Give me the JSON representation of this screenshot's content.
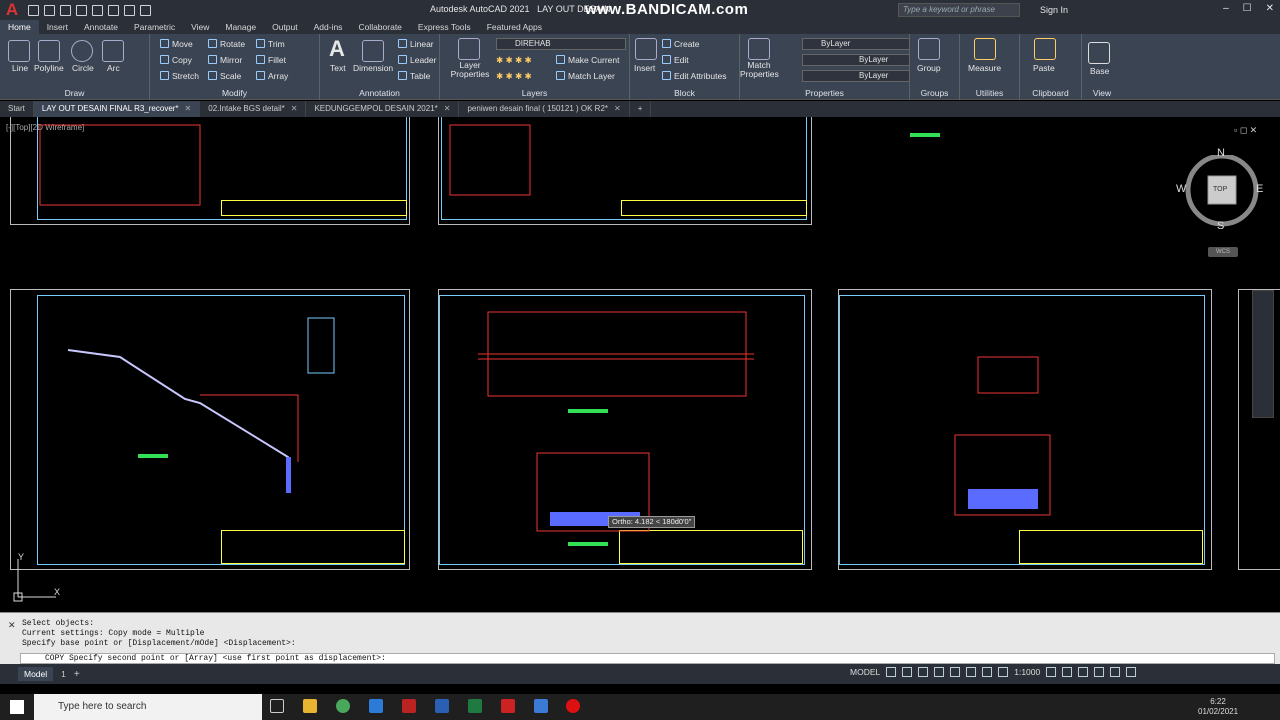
{
  "app": {
    "title": "Autodesk AutoCAD 2021",
    "title_suffix": "LAY OUT DESAIN",
    "watermark": "www.BANDICAM.com",
    "search_placeholder": "Type a keyword or phrase",
    "sign_in": "Sign In"
  },
  "menu_tabs": [
    "Home",
    "Insert",
    "Annotate",
    "Parametric",
    "View",
    "Manage",
    "Output",
    "Add-ins",
    "Collaborate",
    "Express Tools",
    "Featured Apps"
  ],
  "ribbon": {
    "draw": {
      "title": "Draw",
      "tools": [
        "Line",
        "Polyline",
        "Circle",
        "Arc"
      ]
    },
    "modify": {
      "title": "Modify",
      "tools": [
        "Move",
        "Rotate",
        "Trim",
        "Copy",
        "Mirror",
        "Fillet",
        "Stretch",
        "Scale",
        "Array"
      ]
    },
    "annotation": {
      "title": "Annotation",
      "tools": [
        "Text",
        "Dimension",
        "Linear",
        "Leader",
        "Table"
      ]
    },
    "layers": {
      "title": "Layers",
      "layer_name": "DIREHAB",
      "tools": [
        "Layer Properties",
        "Make Current",
        "Match Layer"
      ]
    },
    "block": {
      "title": "Block",
      "tools": [
        "Insert",
        "Create",
        "Edit",
        "Edit Attributes"
      ]
    },
    "properties": {
      "title": "Properties",
      "tools": [
        "Match Properties"
      ],
      "bylayer": [
        "ByLayer",
        "ByLayer",
        "ByLayer"
      ]
    },
    "groups": {
      "title": "Groups",
      "tools": [
        "Group"
      ]
    },
    "utilities": {
      "title": "Utilities",
      "tools": [
        "Measure"
      ]
    },
    "clipboard": {
      "title": "Clipboard",
      "tools": [
        "Paste"
      ]
    },
    "view": {
      "title": "View",
      "tools": [
        "Base"
      ]
    }
  },
  "doc_tabs": [
    "Start",
    "LAY OUT DESAIN FINAL R3_recover*",
    "02.Intake BGS detail*",
    "KEDUNGGEMPOL DESAIN 2021*",
    "peniwen desain final ( 150121 ) OK R2*"
  ],
  "viewport_label": "[-][Top][2D Wireframe]",
  "navcube": {
    "n": "N",
    "s": "S",
    "e": "E",
    "w": "W",
    "top": "TOP",
    "wcs": "WCS"
  },
  "tooltip": "Ortho: 4.182 < 180d0'0\"",
  "command": {
    "lines": [
      "Select objects:",
      "Current settings:  Copy mode = Multiple",
      "Specify base point or [Displacement/mOde] <Displacement>:"
    ],
    "prompt": "COPY Specify second point or [Array] <use first point as displacement>:"
  },
  "status": {
    "model_tab": "Model",
    "layout_tab": "1",
    "mode": "MODEL",
    "scale": "1:1000"
  },
  "taskbar": {
    "search": "Type here to search",
    "time": "6:22",
    "date": "01/02/2021"
  }
}
